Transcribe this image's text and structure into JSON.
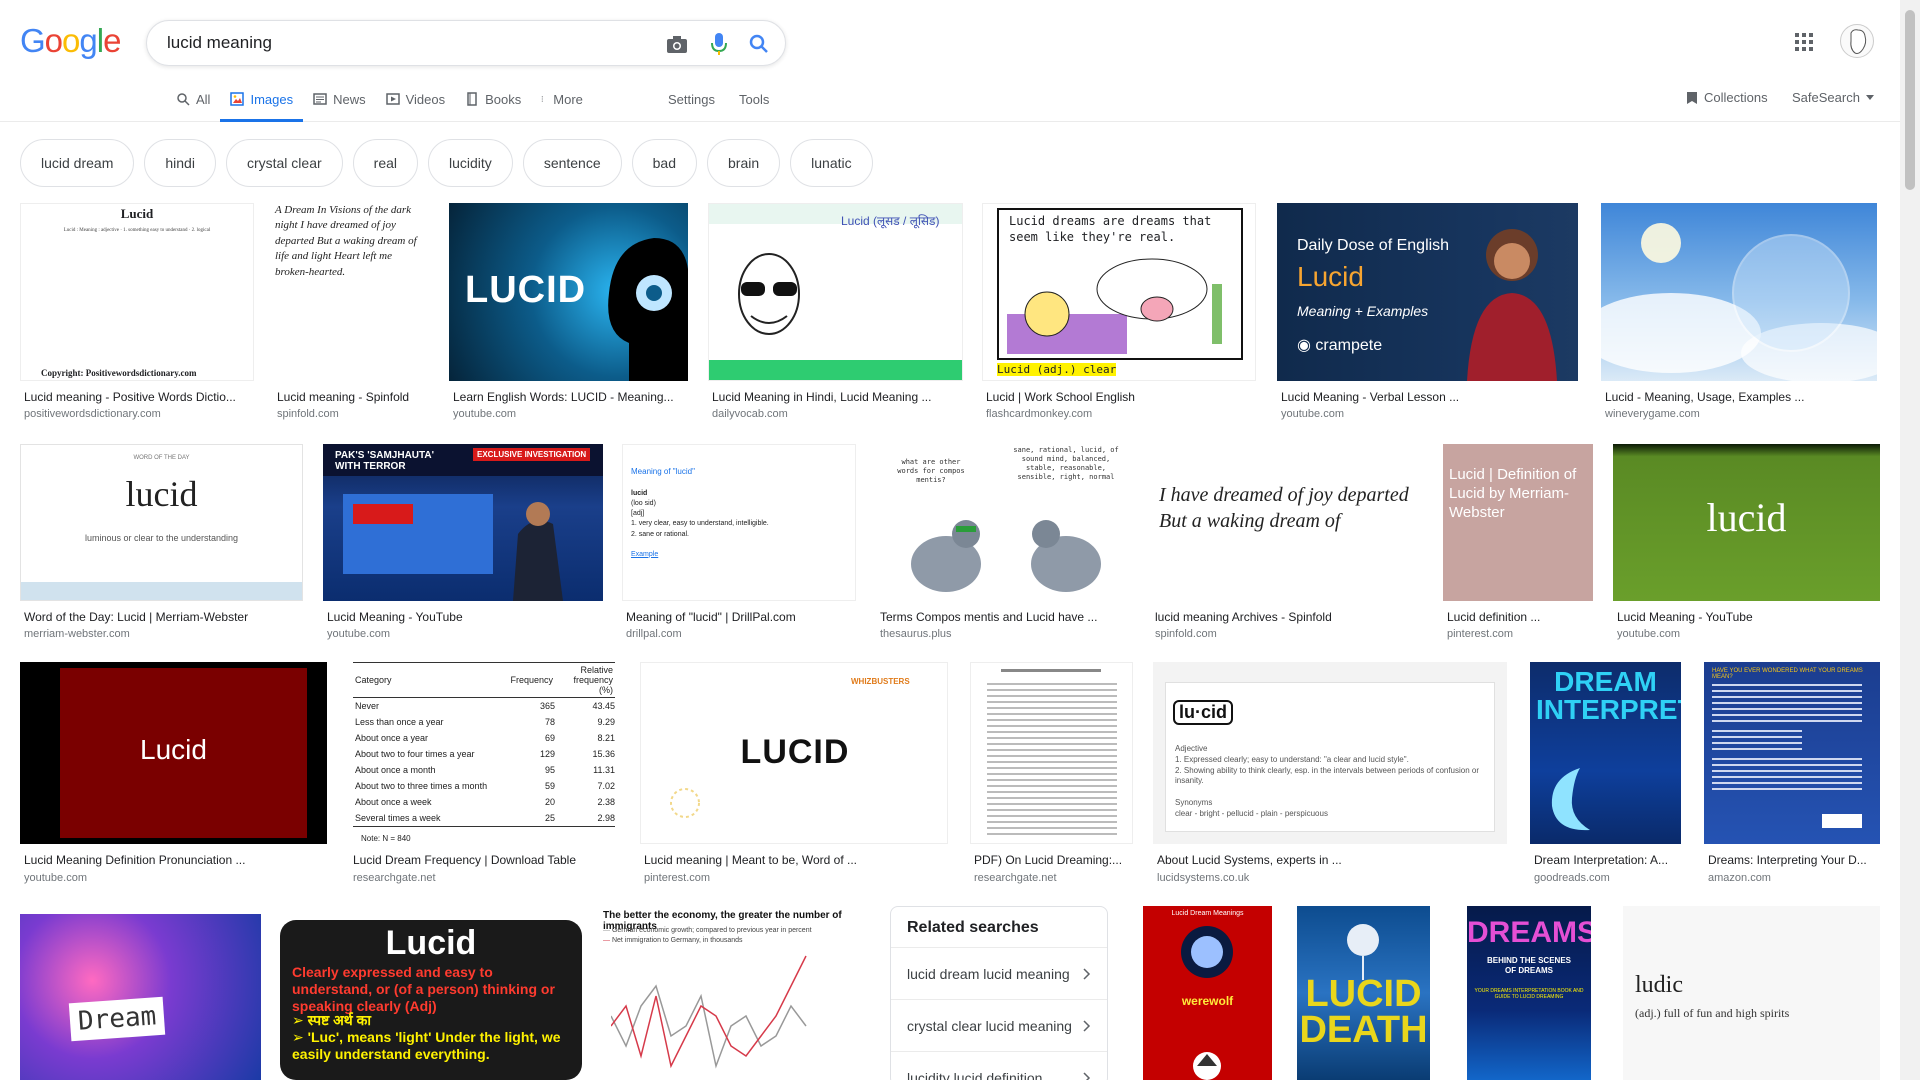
{
  "logo": "Google",
  "search": {
    "value": "lucid meaning"
  },
  "icons": {
    "camera": "camera-icon",
    "mic": "mic-icon",
    "search": "search-icon",
    "apps": "apps-grid-icon"
  },
  "tabs": [
    {
      "label": "All",
      "icon": "search-icon"
    },
    {
      "label": "Images",
      "icon": "image-icon"
    },
    {
      "label": "News",
      "icon": "news-icon"
    },
    {
      "label": "Videos",
      "icon": "video-icon"
    },
    {
      "label": "Books",
      "icon": "book-icon"
    },
    {
      "label": "More",
      "icon": "more-icon"
    }
  ],
  "toolbar": {
    "settings": "Settings",
    "tools": "Tools",
    "collections": "Collections",
    "safesearch": "SafeSearch"
  },
  "chips": [
    "lucid dream",
    "hindi",
    "crystal clear",
    "real",
    "lucidity",
    "sentence",
    "bad",
    "brain",
    "lunatic"
  ],
  "results": [
    {
      "caption": "Lucid meaning - Positive Words Dictio...",
      "source": "positivewordsdictionary.com",
      "thumb_text": "Lucid",
      "sub_text": "Copyright: Positivewordsdictionary.com"
    },
    {
      "caption": "Lucid meaning - Spinfold",
      "source": "spinfold.com",
      "thumb_text": "A Dream  In Visions of the dark night  I have dreamed of joy departed  But a waking dream of life and light  Heart left me broken-hearted."
    },
    {
      "caption": "Learn English Words: LUCID - Meaning...",
      "source": "youtube.com",
      "thumb_text": "LUCID"
    },
    {
      "caption": "Lucid Meaning in Hindi, Lucid Meaning ...",
      "source": "dailyvocab.com",
      "thumb_text": "Lucid (लूसड / लूसिड)"
    },
    {
      "caption": "Lucid | Work School English",
      "source": "flashcardmonkey.com",
      "thumb_text": "Lucid dreams are dreams that seem like they're real.",
      "sub_text": "Lucid (adj.) clear"
    },
    {
      "caption": "Lucid Meaning - Verbal Lesson ...",
      "source": "youtube.com",
      "thumb_text": "Daily Dose of English",
      "sub_text": "Lucid"
    },
    {
      "caption": "Lucid - Meaning, Usage, Examples ...",
      "source": "wineverygame.com"
    },
    {
      "caption": "Word of the Day: Lucid | Merriam-Webster",
      "source": "merriam-webster.com",
      "thumb_text": "lucid"
    },
    {
      "caption": "Lucid Meaning - YouTube",
      "source": "youtube.com",
      "thumb_text": "PAK'S 'SAMJHAUTA' WITH TERROR"
    },
    {
      "caption": "Meaning of \"lucid\" | DrillPal.com",
      "source": "drillpal.com",
      "thumb_text": "Meaning of \"lucid\""
    },
    {
      "caption": "Terms Compos mentis and Lucid have ...",
      "source": "thesaurus.plus"
    },
    {
      "caption": "lucid meaning Archives - Spinfold",
      "source": "spinfold.com",
      "thumb_text": "I have dreamed of joy departed  But a waking dream of"
    },
    {
      "caption": "Lucid definition ...",
      "source": "pinterest.com",
      "thumb_text": "Lucid | Definition of Lucid by Merriam-Webster"
    },
    {
      "caption": "Lucid Meaning - YouTube",
      "source": "youtube.com",
      "thumb_text": "lucid"
    },
    {
      "caption": "Lucid Meaning Definition Pronunciation ...",
      "source": "youtube.com",
      "thumb_text": "Lucid"
    },
    {
      "caption": "Lucid Dream Frequency | Download Table",
      "source": "researchgate.net"
    },
    {
      "caption": "Lucid meaning | Meant to be, Word of ...",
      "source": "pinterest.com",
      "thumb_text": "LUCID"
    },
    {
      "caption": "PDF) On Lucid Dreaming:...",
      "source": "researchgate.net"
    },
    {
      "caption": "About Lucid Systems, experts in ...",
      "source": "lucidsystems.co.uk",
      "thumb_text": "lu·cid"
    },
    {
      "caption": "Dream Interpretation: A...",
      "source": "goodreads.com",
      "thumb_text": "DREAM INTERPRETATION"
    },
    {
      "caption": "Dreams: Interpreting Your D...",
      "source": "amazon.com"
    }
  ],
  "freq_table": {
    "headers": [
      "Category",
      "Frequency",
      "Relative frequency (%)"
    ],
    "rows": [
      [
        "Never",
        "365",
        "43.45"
      ],
      [
        "Less than once a year",
        "78",
        "9.29"
      ],
      [
        "About once a year",
        "69",
        "8.21"
      ],
      [
        "About two to four times a year",
        "129",
        "15.36"
      ],
      [
        "About once a month",
        "95",
        "11.31"
      ],
      [
        "About two to three times a month",
        "59",
        "7.02"
      ],
      [
        "About once a week",
        "20",
        "2.38"
      ],
      [
        "Several times a week",
        "25",
        "2.98"
      ]
    ],
    "note": "Note: N = 840"
  },
  "row4": [
    {
      "thumb_text": "Dream"
    },
    {
      "thumb_text": "Lucid",
      "sub_text": "Clearly expressed and easy to understand, or (of a person) thinking or speaking clearly (Adj)"
    },
    {
      "thumb_text": "The better the economy, the greater the number of immigrants"
    },
    {
      "thumb_text": "werewolf"
    },
    {
      "thumb_text": "LUCID DEATH"
    },
    {
      "thumb_text": "DREAMS"
    },
    {
      "thumb_text": "ludic",
      "sub_text": "(adj.) full of fun and high spirits"
    }
  ],
  "related": {
    "title": "Related searches",
    "items": [
      "lucid dream lucid meaning",
      "crystal clear lucid meaning",
      "lucidity lucid definition"
    ]
  }
}
